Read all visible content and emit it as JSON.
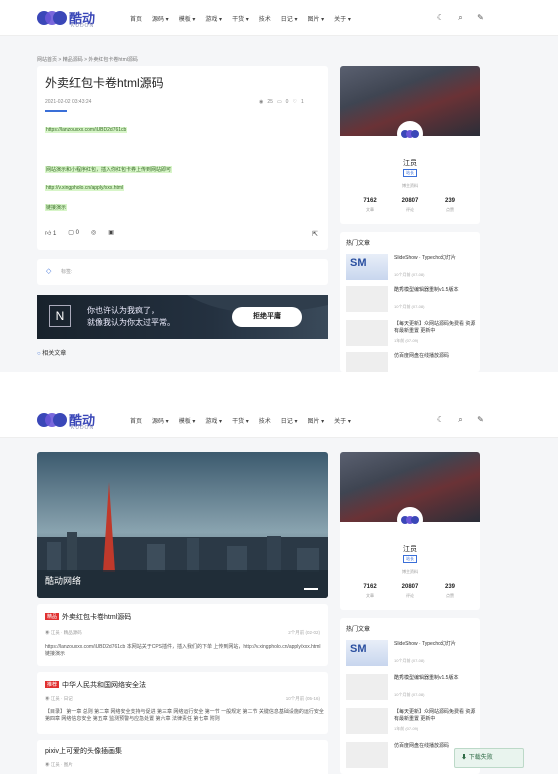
{
  "header": {
    "logo_text": "酷动",
    "logo_sub": "KUDON",
    "nav": [
      "首页",
      "源码 ▾",
      "模板 ▾",
      "游戏 ▾",
      "干货 ▾",
      "技术",
      "日记 ▾",
      "图片 ▾",
      "关于 ▾"
    ],
    "icons": [
      "moon-icon",
      "search-icon",
      "edit-icon"
    ]
  },
  "top": {
    "breadcrumb": "网站首页 > 精品源码 > 外卖红包卡卷html源码",
    "article": {
      "title": "外卖红包卡卷html源码",
      "date": "2021-02-02 03:43:24",
      "views": "25",
      "comments": "0",
      "likes": "1",
      "lines": [
        "https://lanzouxxx.com/iUBD2d761cb",
        "网站演示和小程序红包，插入你红包卡券上传到网站即可",
        "http://v.xingpholo.cn/apply/xxx.html",
        "链接演示"
      ],
      "actions": [
        "1",
        "0",
        "",
        ""
      ]
    },
    "tag": "标签:",
    "banner_text": [
      "你也许认为我疯了，",
      "就像我认为你太过平常。"
    ],
    "banner_button": "拒绝平庸",
    "related": "相关文章",
    "profile": {
      "name": "江员",
      "badge": "站长",
      "desc": "博主资料",
      "stats": [
        {
          "num": "7162",
          "label": "文章"
        },
        {
          "num": "20807",
          "label": "评论"
        },
        {
          "num": "239",
          "label": "点赞"
        }
      ]
    },
    "recent_title": "热门文章",
    "recent": [
      {
        "title": "SlideShow · Typecho幻灯片",
        "date": "10个月前 (07-08)"
      },
      {
        "title": "酷秀模型编辑器重制v1.5版本",
        "date": "10个月前 (07-08)"
      },
      {
        "title": "【每天更新】众网站源码免费看 资源有最新重置 更新中",
        "date": "1年前 (07-09)"
      },
      {
        "title": "仿百度网盘在线播放源码",
        "date": ""
      }
    ]
  },
  "bottom": {
    "hero_caption": "酷动网络",
    "posts": [
      {
        "badge": "精品",
        "title": "外卖红包卡卷html源码",
        "author": "江员",
        "category": "精品源码",
        "date": "2个月前 (02-02)",
        "body": "https://lanzouxxx.com/iUBD2d761cb 本网站关于CPS插件，插入我们的下单 上传到网站，http://v.xingpholo.cn/apply/xxx.html 链接演示"
      },
      {
        "badge": "推荐",
        "title": "中华人民共和国网络安全法",
        "author": "江员",
        "category": "日记",
        "date": "10个月前 (05-16)",
        "body": "【目录】 第一章 总则 第二章 网络安全支持与促进 第三章 网络运行安全 第一节 一般规定 第二节 关键信息基础设施的运行安全 第四章 网络信息安全 第五章 监测预警与应急处置 第六章 法律责任 第七章 附则"
      },
      {
        "badge": "",
        "title": "pixiv上可爱的头像插画集",
        "author": "江员",
        "category": "图片",
        "date": "",
        "body": ""
      }
    ],
    "profile": {
      "name": "江员",
      "badge": "站长",
      "desc": "博主资料",
      "stats": [
        {
          "num": "7162",
          "label": "文章"
        },
        {
          "num": "20807",
          "label": "评论"
        },
        {
          "num": "239",
          "label": "点赞"
        }
      ]
    },
    "recent_title": "热门文章",
    "recent": [
      {
        "title": "SlideShow · Typecho幻灯片",
        "date": "10个月前 (07-08)"
      },
      {
        "title": "酷秀模型编辑器重制v1.5版本",
        "date": "10个月前 (07-08)"
      },
      {
        "title": "【每天更新】众网站源码免费看 资源有最新重置 更新中",
        "date": "1年前 (07-09)"
      },
      {
        "title": "仿百度网盘在线播放源码",
        "date": ""
      }
    ],
    "download_bar": "下载失败"
  },
  "colors": {
    "brand": "#3a47b8",
    "accent": "#3a6fd8",
    "badge": "#e03030",
    "highlight": "#d7f5c8"
  }
}
